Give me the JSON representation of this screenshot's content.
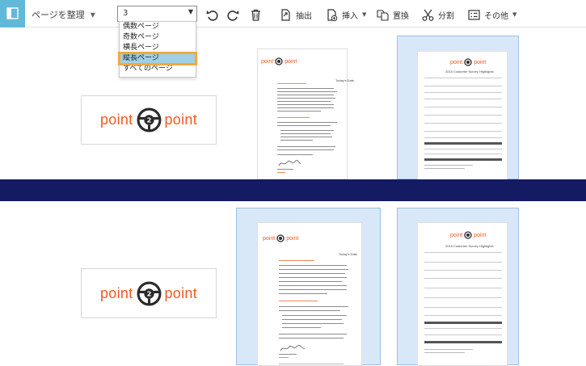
{
  "toolbar": {
    "organize_label": "ページを整理",
    "page_selection_value": "3",
    "extract_label": "抽出",
    "insert_label": "挿入",
    "replace_label": "置換",
    "split_label": "分割",
    "more_label": "その他"
  },
  "page_selection_options": [
    "偶数ページ",
    "奇数ページ",
    "横長ページ",
    "縦長ページ",
    "すべてのページ"
  ],
  "selected_option": "縦長ページ",
  "logo": {
    "word1": "point",
    "word2": "point",
    "center": "2"
  },
  "letter_page": {
    "date": "Today's Date"
  },
  "survey_page": {
    "title": "2015 Customer Survey Highlights"
  },
  "colors": {
    "accent": "#62b8d8",
    "highlight": "#f3a93c",
    "separator": "#141b62",
    "selection": "#d9e8f8",
    "brand": "#f05a22"
  },
  "icons": [
    "sidebar-toggle-icon",
    "undo-icon",
    "redo-icon",
    "trash-icon",
    "extract-icon",
    "insert-icon",
    "replace-icon",
    "scissors-icon",
    "more-icon"
  ]
}
